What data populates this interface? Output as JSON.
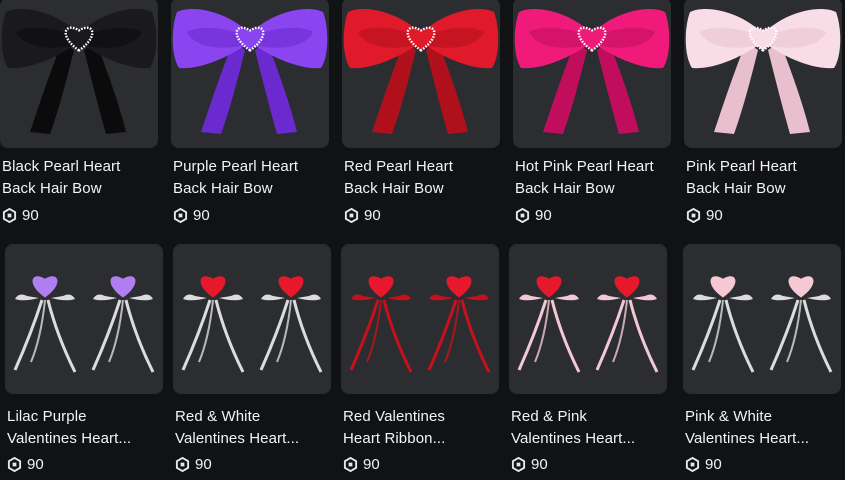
{
  "currency_icon": "robux-icon",
  "items": [
    {
      "line1": "Black Pearl Heart",
      "line2": "Back Hair Bow",
      "price": "90",
      "kind": "bow",
      "color": "#1a1a1c",
      "shade": "#0b0b0c"
    },
    {
      "line1": "Purple Pearl Heart",
      "line2": "Back Hair Bow",
      "price": "90",
      "kind": "bow",
      "color": "#8a44f0",
      "shade": "#6a2ad0"
    },
    {
      "line1": "Red Pearl Heart",
      "line2": "Back Hair Bow",
      "price": "90",
      "kind": "bow",
      "color": "#e01a2a",
      "shade": "#b0101c"
    },
    {
      "line1": "Hot Pink Pearl Heart",
      "line2": "Back Hair Bow",
      "price": "90",
      "kind": "bow",
      "color": "#f01a7a",
      "shade": "#c00e5c"
    },
    {
      "line1": "Pink Pearl Heart",
      "line2": "Back Hair Bow",
      "price": "90",
      "kind": "bow",
      "color": "#f8dde6",
      "shade": "#e8c0cd"
    },
    {
      "line1": "Lilac Purple",
      "line2": "Valentines Heart...",
      "price": "90",
      "kind": "ribbon",
      "heart": "#b07ef0",
      "ribbon": "#dcdcdc"
    },
    {
      "line1": "Red & White",
      "line2": "Valentines Heart...",
      "price": "90",
      "kind": "ribbon",
      "heart": "#e8182c",
      "ribbon": "#dcdcdc"
    },
    {
      "line1": "Red Valentines",
      "line2": "Heart Ribbon...",
      "price": "90",
      "kind": "ribbon",
      "heart": "#e8182c",
      "ribbon": "#c8101c"
    },
    {
      "line1": "Red & Pink",
      "line2": "Valentines Heart...",
      "price": "90",
      "kind": "ribbon",
      "heart": "#e8182c",
      "ribbon": "#f2c8d2"
    },
    {
      "line1": "Pink & White",
      "line2": "Valentines Heart...",
      "price": "90",
      "kind": "ribbon",
      "heart": "#f6c8d4",
      "ribbon": "#dcdcdc"
    }
  ]
}
